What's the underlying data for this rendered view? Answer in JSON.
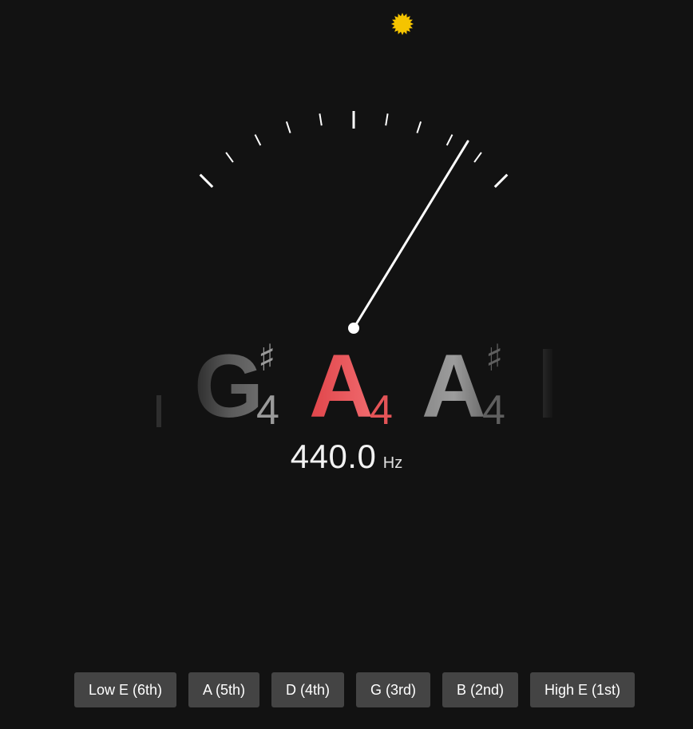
{
  "theme_toggle": {
    "icon": "sun-icon",
    "color": "#f5c400"
  },
  "meter": {
    "tick_color": "#ffffff",
    "needle_color": "#ffffff"
  },
  "notes": {
    "previous": {
      "name": "G",
      "accidental": "♯",
      "octave": "4"
    },
    "current": {
      "name": "A",
      "accidental": "",
      "octave": "4",
      "color": "#e9565a"
    },
    "next": {
      "name": "A",
      "accidental": "♯",
      "octave": "4"
    }
  },
  "frequency": {
    "value": "440.0",
    "unit": "Hz"
  },
  "string_buttons": [
    {
      "label": "Low E (6th)"
    },
    {
      "label": "A (5th)"
    },
    {
      "label": "D (4th)"
    },
    {
      "label": "G (3rd)"
    },
    {
      "label": "B (2nd)"
    },
    {
      "label": "High E (1st)"
    }
  ],
  "colors": {
    "background": "#121212",
    "button_background": "#444444",
    "button_text": "#ffffff"
  }
}
